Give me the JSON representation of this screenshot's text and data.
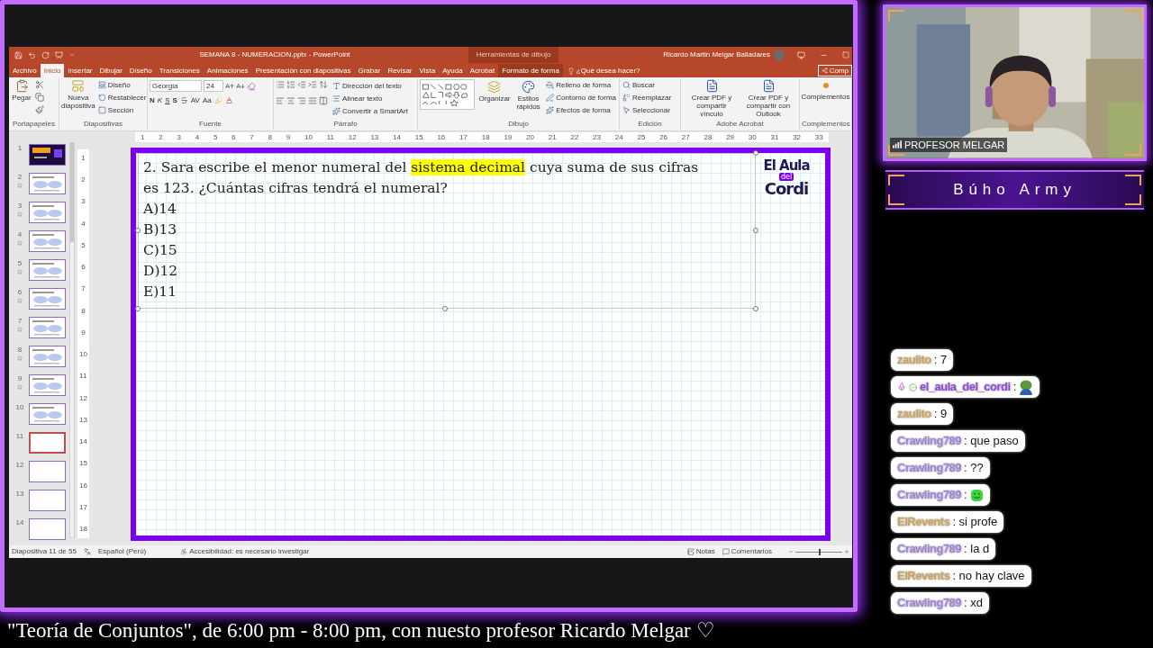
{
  "powerpoint": {
    "title": "SEMANA 8 - NUMERACION.pptx - PowerPoint",
    "context_label": "Herramientas de dibujo",
    "user": "Ricardo Martin Melgar Balladares",
    "tabs": [
      {
        "label": "Archivo",
        "selected": false,
        "contextual": false
      },
      {
        "label": "Inicio",
        "selected": true,
        "contextual": false
      },
      {
        "label": "Insertar",
        "selected": false,
        "contextual": false
      },
      {
        "label": "Dibujar",
        "selected": false,
        "contextual": false
      },
      {
        "label": "Diseño",
        "selected": false,
        "contextual": false
      },
      {
        "label": "Transiciones",
        "selected": false,
        "contextual": false
      },
      {
        "label": "Animaciones",
        "selected": false,
        "contextual": false
      },
      {
        "label": "Presentación con diapositivas",
        "selected": false,
        "contextual": false
      },
      {
        "label": "Grabar",
        "selected": false,
        "contextual": false
      },
      {
        "label": "Revisar",
        "selected": false,
        "contextual": false
      },
      {
        "label": "Vista",
        "selected": false,
        "contextual": false
      },
      {
        "label": "Ayuda",
        "selected": false,
        "contextual": false
      },
      {
        "label": "Acrobat",
        "selected": false,
        "contextual": false
      },
      {
        "label": "Formato de forma",
        "selected": false,
        "contextual": true
      }
    ],
    "tell_me": "¿Qué desea hacer?",
    "share": "Comp",
    "ribbon_groups": [
      {
        "kind": "clipboard",
        "label": "Portapapeles",
        "items": [
          "Pegar"
        ]
      },
      {
        "kind": "slides",
        "label": "Diapositivas",
        "items": [
          "Nueva diapositiva",
          "Diseño",
          "Restablecer",
          "Sección"
        ]
      },
      {
        "kind": "font",
        "label": "Fuente",
        "items": [
          "Georgia",
          "24",
          "N",
          "K",
          "S",
          "S",
          "AV",
          "Aa"
        ]
      },
      {
        "kind": "paragraph",
        "label": "Párrafo",
        "items": [
          "Dirección del texto",
          "Alinear texto",
          "Convertir a SmartArt"
        ]
      },
      {
        "kind": "drawing",
        "label": "Dibujo",
        "items": [
          "Organizar",
          "Estilos rápidos",
          "Relleno de forma",
          "Contorno de forma",
          "Efectos de forma"
        ]
      },
      {
        "kind": "editing",
        "label": "Edición",
        "items": [
          "Buscar",
          "Reemplazar",
          "Seleccionar"
        ]
      },
      {
        "kind": "acrobat",
        "label": "Adobe Acrobat",
        "items": [
          "Crear PDF y compartir vínculo",
          "Crear PDF y compartir con Outlook"
        ]
      },
      {
        "kind": "addins",
        "label": "Complementos",
        "items": [
          "Complementos"
        ]
      }
    ],
    "ruler_h": [
      "1",
      "2",
      "3",
      "4",
      "5",
      "6",
      "7",
      "8",
      "9",
      "10",
      "11",
      "12",
      "13",
      "14",
      "15",
      "16",
      "17",
      "18",
      "19",
      "20",
      "21",
      "22",
      "23",
      "24",
      "25",
      "26",
      "27",
      "28",
      "29",
      "30",
      "31",
      "32",
      "33"
    ],
    "ruler_v": [
      "1",
      "2",
      "3",
      "4",
      "5",
      "6",
      "7",
      "8",
      "9",
      "10",
      "11",
      "12",
      "13",
      "14",
      "15",
      "16",
      "17",
      "18"
    ],
    "thumbnails": [
      {
        "number": "1",
        "kind": "title",
        "animated": false,
        "selected": false
      },
      {
        "number": "2",
        "kind": "content",
        "animated": true,
        "selected": false
      },
      {
        "number": "3",
        "kind": "content",
        "animated": true,
        "selected": false
      },
      {
        "number": "4",
        "kind": "content",
        "animated": true,
        "selected": false
      },
      {
        "number": "5",
        "kind": "content",
        "animated": true,
        "selected": false
      },
      {
        "number": "6",
        "kind": "content",
        "animated": true,
        "selected": false
      },
      {
        "number": "7",
        "kind": "content",
        "animated": true,
        "selected": false
      },
      {
        "number": "8",
        "kind": "content",
        "animated": true,
        "selected": false
      },
      {
        "number": "9",
        "kind": "content",
        "animated": true,
        "selected": false
      },
      {
        "number": "10",
        "kind": "content",
        "animated": false,
        "selected": false
      },
      {
        "number": "11",
        "kind": "blank",
        "animated": false,
        "selected": true
      },
      {
        "number": "12",
        "kind": "blank",
        "animated": false,
        "selected": false
      },
      {
        "number": "13",
        "kind": "blank",
        "animated": false,
        "selected": false
      },
      {
        "number": "14",
        "kind": "blank",
        "animated": false,
        "selected": false
      }
    ],
    "slide": {
      "question": [
        [
          {
            "text": "2. Sara escribe el menor numeral del ",
            "highlight": false
          },
          {
            "text": "sistema decimal",
            "highlight": true
          },
          {
            "text": " cuya suma de sus cifras",
            "highlight": false
          }
        ],
        [
          {
            "text": "es 123. ¿Cuántas cifras tendrá el numeral?",
            "highlight": false
          }
        ]
      ],
      "options": [
        "A)14",
        "B)13",
        "C)15",
        "D)12",
        "E)11"
      ],
      "logo": [
        "El Aula",
        "del",
        "Cordi"
      ]
    },
    "status": {
      "slide": "Diapositiva 11 de 55",
      "language": "Español (Perú)",
      "accessibility": "Accesibilidad: es necesario investigar",
      "notes": "Notas",
      "comments": "Comentarios",
      "zoom": {
        "level": 0.52
      }
    }
  },
  "webcam": {
    "name_tag": "PROFESOR MELGAR"
  },
  "channel_title": "Búho Army",
  "chat": [
    {
      "user": "zaulito",
      "color": "#c9a25a",
      "kind": "text",
      "text": ": 7",
      "badged": false
    },
    {
      "user": "el_aula_del_cordi",
      "color": "#8e44d6",
      "kind": "frog",
      "text": ":",
      "badged": true
    },
    {
      "user": "zaulito",
      "color": "#c9a25a",
      "kind": "text",
      "text": ": 9",
      "badged": false
    },
    {
      "user": "Crawling789",
      "color": "#9d7fd6",
      "kind": "text",
      "text": ": que paso",
      "badged": false
    },
    {
      "user": "Crawling789",
      "color": "#9d7fd6",
      "kind": "text",
      "text": ": ??",
      "badged": false
    },
    {
      "user": "Crawling789",
      "color": "#9d7fd6",
      "kind": "smile",
      "text": ":",
      "badged": false
    },
    {
      "user": "ElRevents",
      "color": "#c9a25a",
      "kind": "text",
      "text": ": si profe",
      "badged": false
    },
    {
      "user": "Crawling789",
      "color": "#9d7fd6",
      "kind": "text",
      "text": ": la d",
      "badged": false
    },
    {
      "user": "ElRevents",
      "color": "#c9a25a",
      "kind": "text",
      "text": ": no hay clave",
      "badged": false
    },
    {
      "user": "Crawling789",
      "color": "#9d7fd6",
      "kind": "text",
      "text": ": xd",
      "badged": false
    }
  ],
  "ticker": "\"Teoría de Conjuntos\", de 6:00 pm - 8:00 pm, con nuesto profesor Ricardo Melgar ♡"
}
